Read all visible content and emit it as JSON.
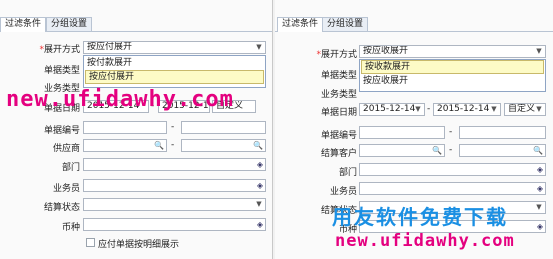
{
  "left": {
    "tabs": [
      "过滤条件",
      "分组设置"
    ],
    "expand_label": "展开方式",
    "expand_value": "按应付展开",
    "options": [
      "按付款展开",
      "按应付展开"
    ],
    "doc_type_label": "单据类型",
    "biz_type_label": "业务类型",
    "doc_date_label": "单据日期",
    "date_from": "2015-12-14",
    "date_to": "2015-12-14",
    "period": "自定义",
    "doc_no_label": "单据编号",
    "partner_label": "供应商",
    "dept_label": "部门",
    "staff_label": "业务员",
    "status_label": "结算状态",
    "currency_label": "币种",
    "checkbox_label": "应付单据按明细展示",
    "watermark": "new.ufidawhy.com"
  },
  "right": {
    "tabs": [
      "过滤条件",
      "分组设置"
    ],
    "expand_label": "展开方式",
    "expand_value": "按应收展开",
    "options": [
      "按收款展开",
      "按应收展开"
    ],
    "doc_type_label": "单据类型",
    "biz_type_label": "业务类型",
    "doc_date_label": "单据日期",
    "date_from": "2015-12-14",
    "date_to": "2015-12-14",
    "period": "自定义",
    "doc_no_label": "单据编号",
    "partner_label": "结算客户",
    "dept_label": "部门",
    "staff_label": "业务员",
    "status_label": "结算状态",
    "currency_label": "币种",
    "watermark_cn": "用友软件免费下载",
    "watermark": "new.ufidawhy.com"
  }
}
